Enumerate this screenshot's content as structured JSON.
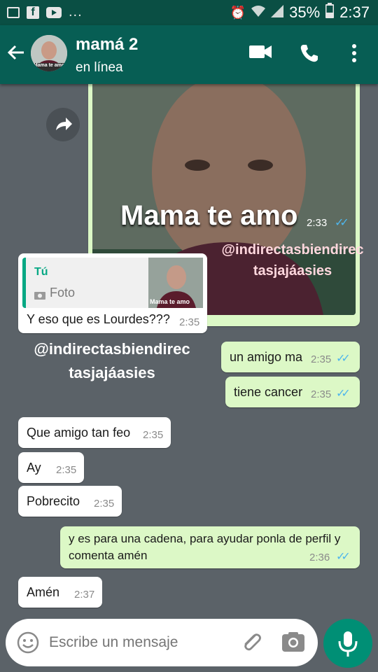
{
  "status_bar": {
    "battery": "35%",
    "time": "2:37",
    "more": "..."
  },
  "header": {
    "contact_name": "mamá 2",
    "status": "en línea",
    "avatar_caption": "Mama te amo"
  },
  "messages": {
    "image": {
      "caption": "Mama te amo",
      "time": "2:33"
    },
    "reply": {
      "quoted_author": "Tú",
      "quoted_type": "Foto",
      "quoted_thumb_caption": "Mama te amo",
      "text": "Y eso que es Lourdes???",
      "time": "2:35"
    },
    "m1": {
      "text": "un amigo ma",
      "time": "2:35"
    },
    "m2": {
      "text": "tiene cancer",
      "time": "2:35"
    },
    "m3": {
      "text": "Que amigo tan feo",
      "time": "2:35"
    },
    "m4": {
      "text": "Ay",
      "time": "2:35"
    },
    "m5": {
      "text": "Pobrecito",
      "time": "2:35"
    },
    "m6": {
      "line1": "y es para una cadena, para ayudar ponla de perfil y",
      "line2": "comenta amén",
      "time": "2:36"
    },
    "m7": {
      "text": "Amén",
      "time": "2:37"
    }
  },
  "watermarks": {
    "top_line1": "@indirectasbiendirec",
    "top_line2": "tasjajáasies",
    "mid_line1": "@indirectasbiendirec",
    "mid_line2": "tasjajáasies"
  },
  "composer": {
    "placeholder": "Escribe un mensaje"
  },
  "colors": {
    "header": "#075e54",
    "chat_bg": "#5b6268",
    "outgoing": "#dcf8c6",
    "incoming": "#ffffff",
    "ticks": "#4fb6ec",
    "fab": "#008f75"
  }
}
